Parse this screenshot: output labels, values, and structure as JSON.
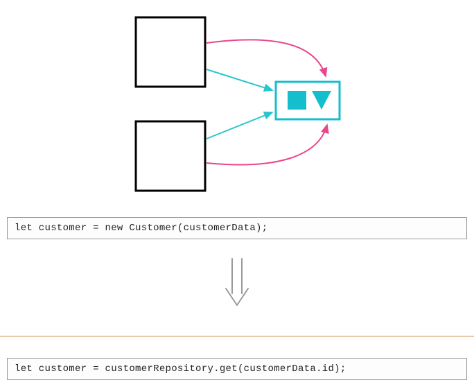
{
  "code": {
    "before": "let customer = new Customer(customerData);",
    "after": "let customer = customerRepository.get(customerData.id);"
  },
  "colors": {
    "arrow_teal": "#2bc5ce",
    "arrow_pink": "#e8478b",
    "shape_teal": "#15becd",
    "divider": "#e8c9a8",
    "box_border": "#000000",
    "downarrow": "#999999"
  }
}
